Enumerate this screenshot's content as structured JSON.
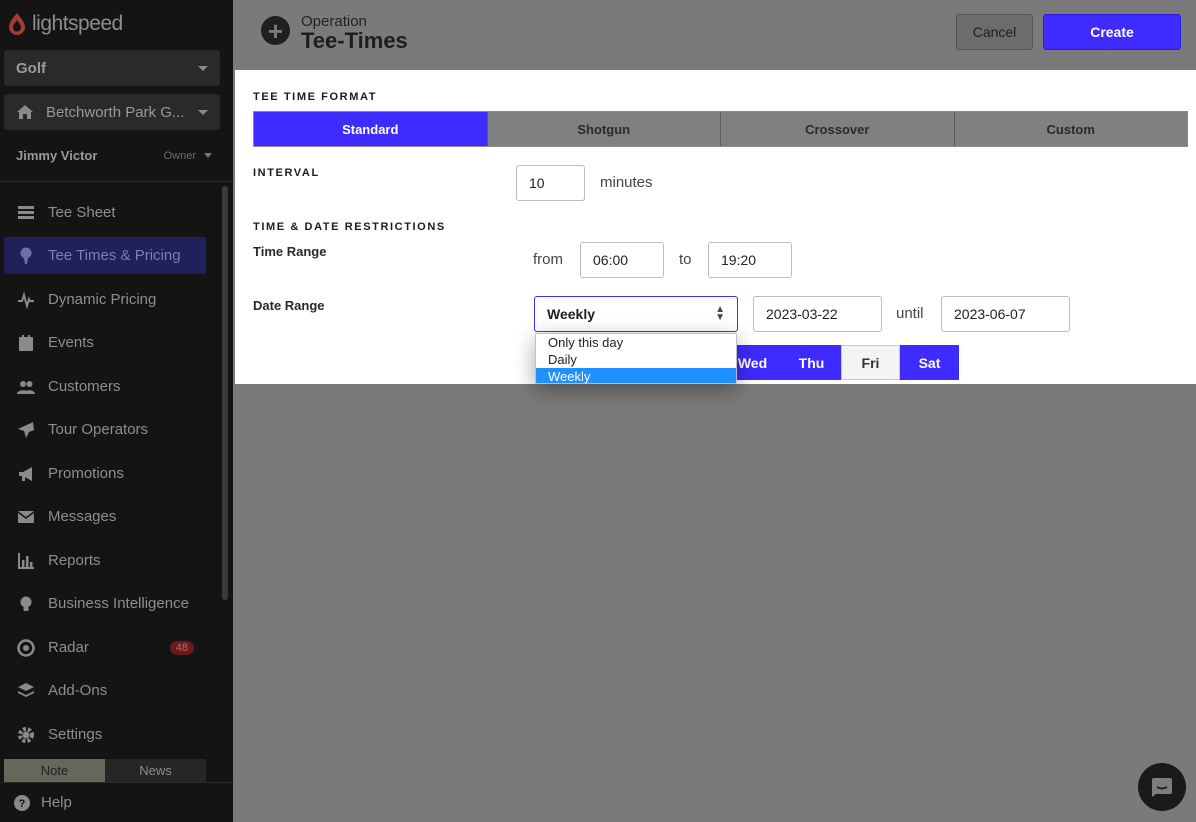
{
  "brand": {
    "name": "lightspeed"
  },
  "sidebar": {
    "vertical": "Golf",
    "course": "Betchworth Park G...",
    "user_name": "Jimmy Victor",
    "user_role": "Owner",
    "items": [
      {
        "label": "Tee Sheet",
        "icon": "table-icon"
      },
      {
        "label": "Tee Times & Pricing",
        "icon": "golf-tee-icon",
        "active": true
      },
      {
        "label": "Dynamic Pricing",
        "icon": "pulse-icon"
      },
      {
        "label": "Events",
        "icon": "calendar-icon"
      },
      {
        "label": "Customers",
        "icon": "users-icon"
      },
      {
        "label": "Tour Operators",
        "icon": "plane-icon"
      },
      {
        "label": "Promotions",
        "icon": "megaphone-icon"
      },
      {
        "label": "Messages",
        "icon": "envelope-icon"
      },
      {
        "label": "Reports",
        "icon": "bar-chart-icon"
      },
      {
        "label": "Business Intelligence",
        "icon": "lightbulb-icon"
      },
      {
        "label": "Radar",
        "icon": "radar-icon",
        "badge": "48"
      },
      {
        "label": "Add-Ons",
        "icon": "layers-icon"
      },
      {
        "label": "Settings",
        "icon": "gear-icon"
      }
    ],
    "bottom_tabs": {
      "note": "Note",
      "news": "News"
    },
    "help": "Help"
  },
  "header": {
    "subtitle": "Operation",
    "title": "Tee-Times",
    "cancel_label": "Cancel",
    "create_label": "Create"
  },
  "form": {
    "format_label": "TEE TIME FORMAT",
    "formats": [
      "Standard",
      "Shotgun",
      "Crossover",
      "Custom"
    ],
    "selected_format": "Standard",
    "interval_label": "INTERVAL",
    "interval_value": "10",
    "interval_unit": "minutes",
    "restrictions_label": "TIME & DATE RESTRICTIONS",
    "time_range_label": "Time Range",
    "from_label": "from",
    "time_from": "06:00",
    "to_label": "to",
    "time_to": "19:20",
    "date_range_label": "Date Range",
    "date_range_mode": "Weekly",
    "date_from": "2023-03-22",
    "until_label": "until",
    "date_to": "2023-06-07",
    "date_range_options": [
      "Only this day",
      "Daily",
      "Weekly"
    ],
    "days": [
      {
        "label": "Wed",
        "on": true
      },
      {
        "label": "Thu",
        "on": true
      },
      {
        "label": "Fri",
        "on": false
      },
      {
        "label": "Sat",
        "on": true
      }
    ]
  },
  "colors": {
    "accent": "#3d2bff",
    "sidebar_bg": "#141414",
    "overlay": "#7a7a7a",
    "option_highlight": "#1e90ff"
  }
}
